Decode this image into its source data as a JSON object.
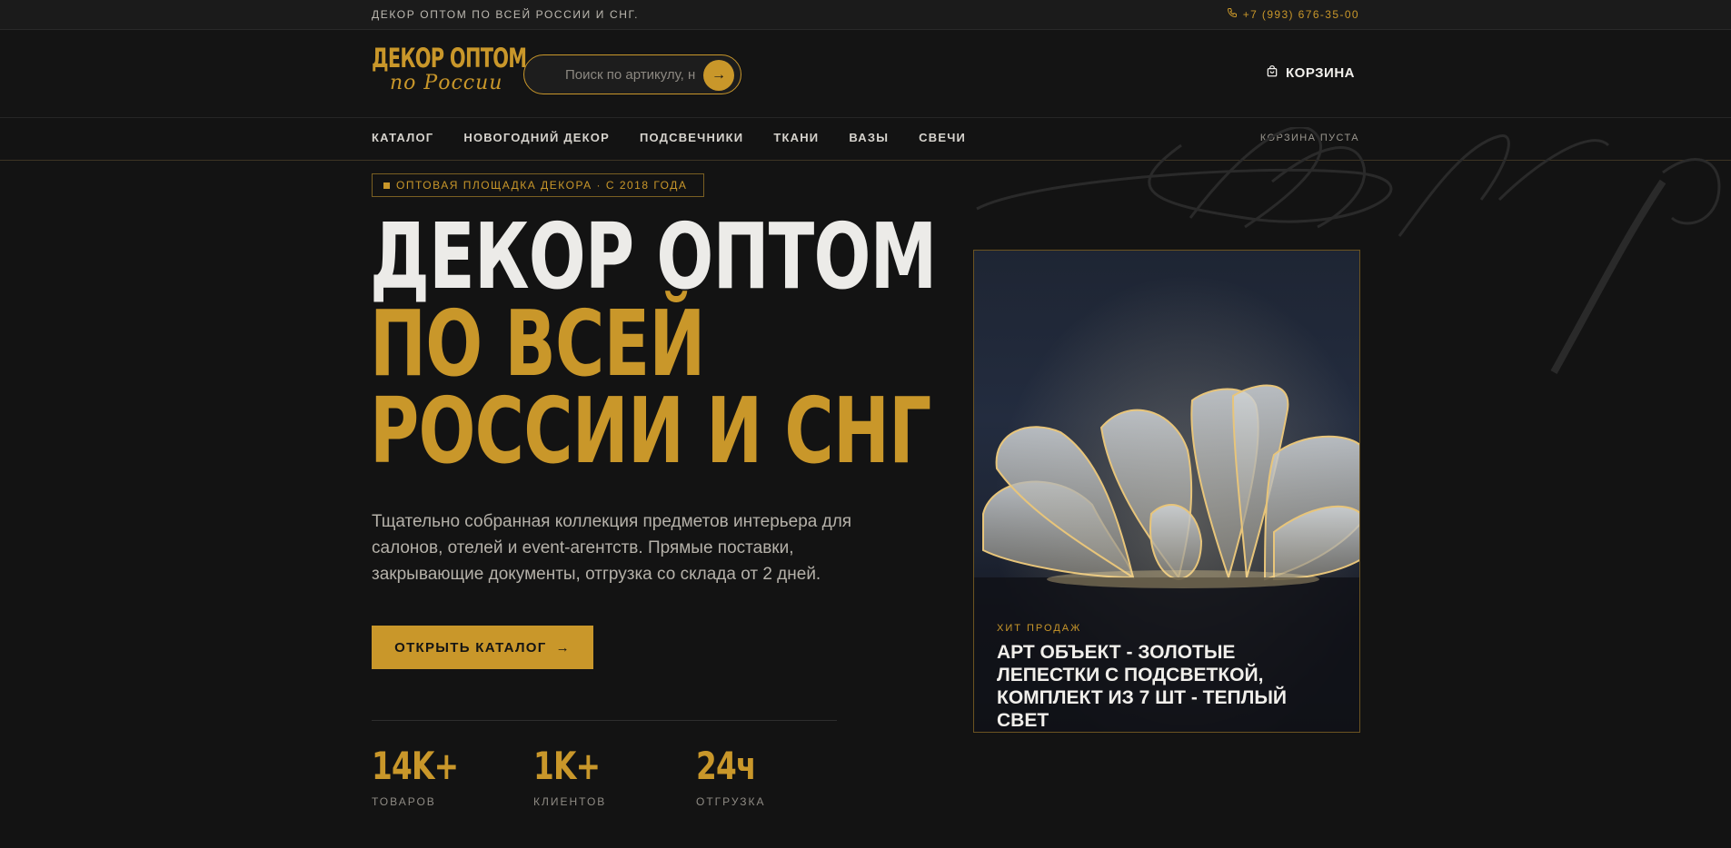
{
  "topbar": {
    "tagline": "ДЕКОР ОПТОМ ПО ВСЕЙ РОССИИ И СНГ.",
    "phone": "+7 (993) 676-35-00"
  },
  "header": {
    "logo_line1": "ДЕКОР ОПТОМ",
    "logo_line2": "по России",
    "search_placeholder": "Поиск по артикулу, н",
    "cart_label": "КОРЗИНА"
  },
  "nav": {
    "items": [
      {
        "label": "КАТАЛОГ"
      },
      {
        "label": "НОВОГОДНИЙ ДЕКОР"
      },
      {
        "label": "ПОДСВЕЧНИКИ"
      },
      {
        "label": "ТКАНИ"
      },
      {
        "label": "ВАЗЫ"
      },
      {
        "label": "СВЕЧИ"
      }
    ],
    "cart_status": "КОРЗИНА ПУСТА"
  },
  "hero": {
    "badge": "ОПТОВАЯ ПЛОЩАДКА ДЕКОРА · С 2018 ГОДА",
    "title_line1": "ДЕКОР ОПТОМ",
    "title_line2": "ПО ВСЕЙ",
    "title_line3": "РОССИИ И СНГ",
    "lead": "Тщательно собранная коллекция предметов интерьера для салонов, отелей и event-агентств. Прямые поставки, закрывающие документы, отгрузка со склада от 2 дней.",
    "cta_label": "ОТКРЫТЬ КАТАЛОГ"
  },
  "stats": [
    {
      "value": "14K+",
      "label": "ТОВАРОВ"
    },
    {
      "value": "1K+",
      "label": "КЛИЕНТОВ"
    },
    {
      "value": "24ч",
      "label": "ОТГРУЗКА"
    }
  ],
  "featured": {
    "tag": "ХИТ ПРОДАЖ",
    "title": "АРТ ОБЪЕКТ - ЗОЛОТЫЕ ЛЕПЕСТКИ С ПОДСВЕТКОЙ, КОМПЛЕКТ ИЗ 7 ШТ - ТЕПЛЫЙ СВЕТ"
  },
  "colors": {
    "accent": "#c9972a",
    "background": "#131313",
    "text": "#ecebe8"
  },
  "icons": [
    "phone-icon",
    "search-arrow-icon",
    "bag-icon",
    "arrow-right-icon",
    "square-bullet-icon"
  ]
}
